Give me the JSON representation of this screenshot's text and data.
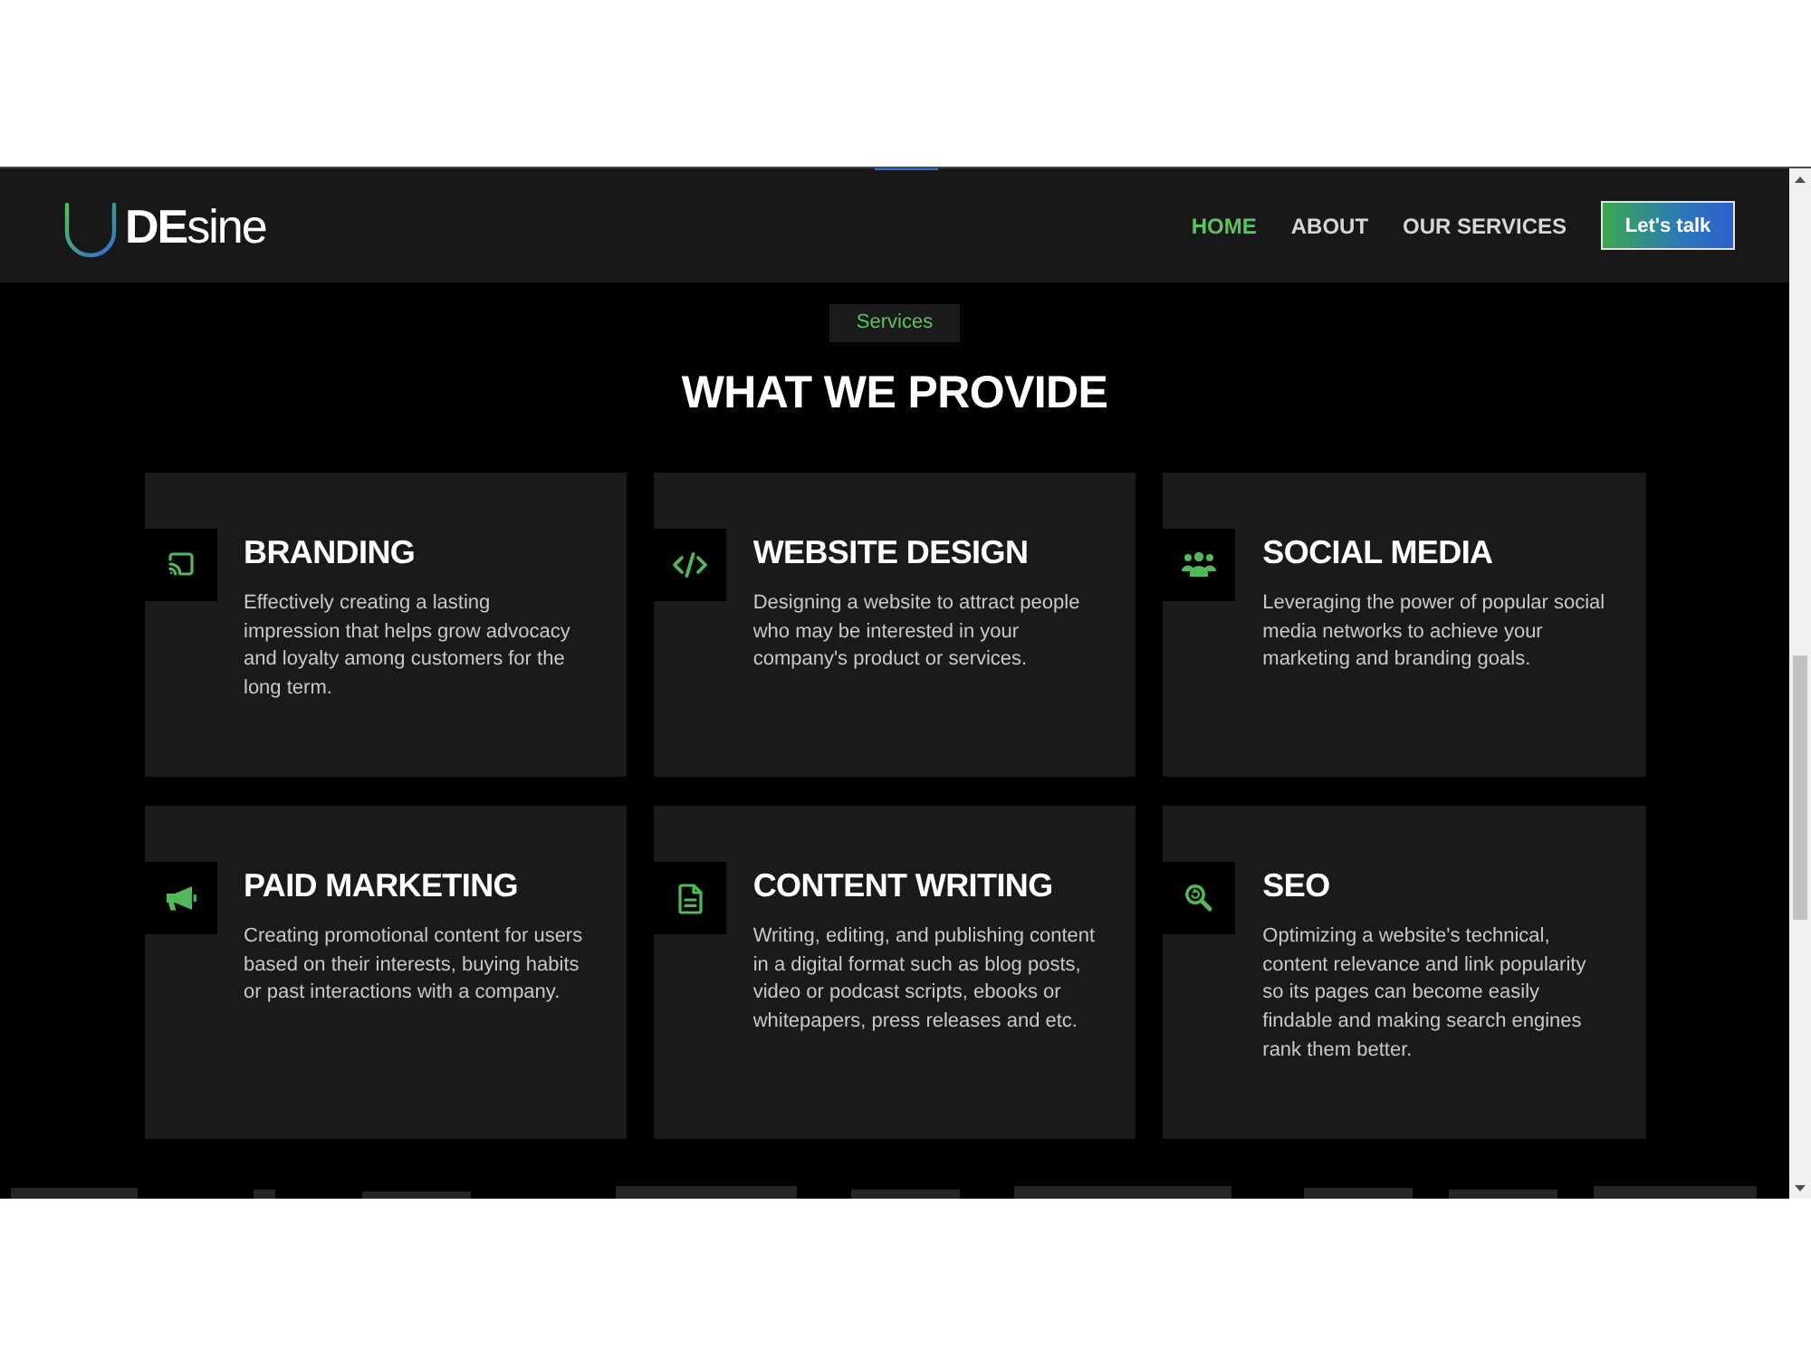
{
  "header": {
    "logo": {
      "text": "**DE**sine"
    },
    "nav": [
      {
        "label": "HOME",
        "selected": true
      },
      {
        "label": "ABOUT",
        "selected": false
      },
      {
        "label": "OUR SERVICES",
        "selected": false
      }
    ],
    "cta_button": "Let's talk"
  },
  "section": {
    "badge": "Services",
    "title": "WHAT WE PROVIDE"
  },
  "services": [
    {
      "kind": "cast",
      "title": "BRANDING",
      "description": "Effectively creating a lasting impression that helps grow advocacy and loyalty among customers for the long term."
    },
    {
      "kind": "code",
      "title": "WEBSITE DESIGN",
      "description": "Designing a website to attract people who may be interested in your company's product or services."
    },
    {
      "kind": "users",
      "title": "SOCIAL MEDIA",
      "description": "Leveraging the power of popular social media networks to achieve your marketing and branding goals."
    },
    {
      "kind": "megaphone",
      "title": "PAID MARKETING",
      "description": "Creating promotional content for users based on their interests, buying habits or past interactions with a company."
    },
    {
      "kind": "document",
      "title": "CONTENT WRITING",
      "description": "Writing, editing, and publishing content in a digital format such as blog posts, video or podcast scripts, ebooks or whitepapers, press releases and etc."
    },
    {
      "kind": "seo",
      "title": "SEO",
      "description": "Optimizing a website's technical, content relevance and link popularity so its pages can become easily findable and making search engines rank them better."
    }
  ]
}
